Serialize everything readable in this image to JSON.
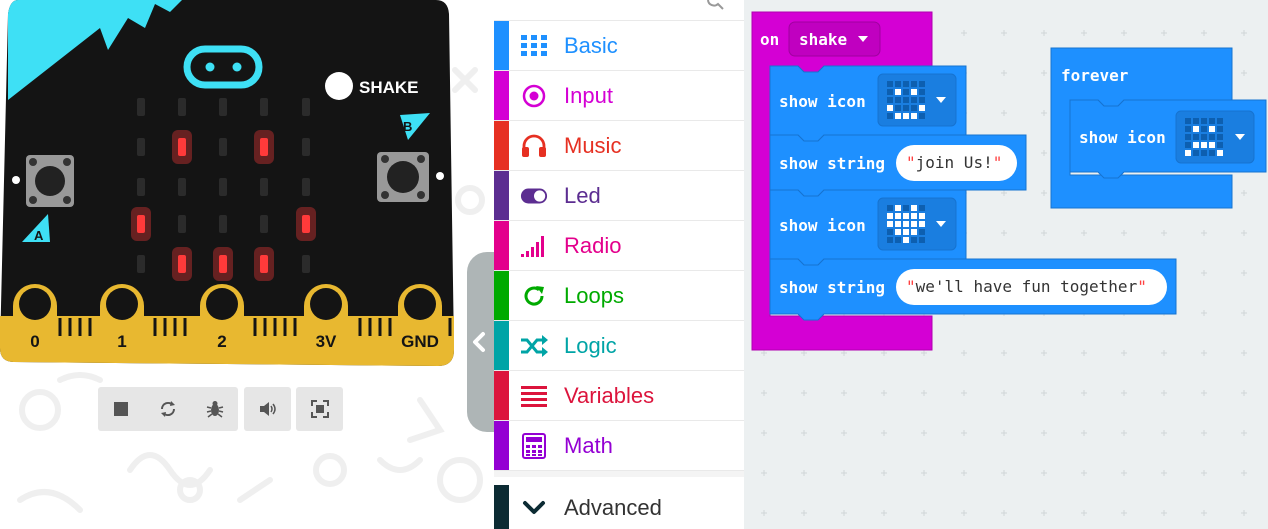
{
  "simulator": {
    "pin_labels": [
      "0",
      "1",
      "2",
      "3V",
      "GND"
    ],
    "shake_label": "SHAKE",
    "button_a_label": "A",
    "button_b_label": "B",
    "led_matrix": [
      [
        0,
        0,
        0,
        0,
        0
      ],
      [
        0,
        1,
        0,
        1,
        0
      ],
      [
        0,
        0,
        0,
        0,
        0
      ],
      [
        1,
        0,
        0,
        0,
        1
      ],
      [
        0,
        1,
        1,
        1,
        0
      ]
    ],
    "colors": {
      "board": "#141414",
      "accent": "#3ee0f5",
      "led_on": "#ff3a3a",
      "gold": "#e8b830"
    }
  },
  "controls": {
    "icons": [
      "stop-icon",
      "restart-icon",
      "debug-icon",
      "mute-icon",
      "fullscreen-icon"
    ]
  },
  "toolbox": {
    "categories": [
      {
        "label": "Basic",
        "color": "#1e90ff",
        "icon": "grid-icon"
      },
      {
        "label": "Input",
        "color": "#d400d4",
        "icon": "target-icon"
      },
      {
        "label": "Music",
        "color": "#e63022",
        "icon": "headphones-icon"
      },
      {
        "label": "Led",
        "color": "#5c2d91",
        "icon": "toggle-icon"
      },
      {
        "label": "Radio",
        "color": "#e3008c",
        "icon": "signal-icon"
      },
      {
        "label": "Loops",
        "color": "#00aa00",
        "icon": "refresh-icon"
      },
      {
        "label": "Logic",
        "color": "#00a4a6",
        "icon": "shuffle-icon"
      },
      {
        "label": "Variables",
        "color": "#dc143c",
        "icon": "list-icon"
      },
      {
        "label": "Math",
        "color": "#9400d3",
        "icon": "calculator-icon"
      }
    ],
    "advanced": {
      "label": "Advanced",
      "color": "#0c2b33"
    }
  },
  "workspace": {
    "on_event": {
      "keyword": "on",
      "dropdown_value": "shake",
      "color": "#d400d4",
      "statements": [
        {
          "type": "show icon",
          "icon": "happy"
        },
        {
          "type": "show string",
          "value": "join Us!"
        },
        {
          "type": "show icon",
          "icon": "heart"
        },
        {
          "type": "show string",
          "value": "we'll have fun together"
        }
      ]
    },
    "forever": {
      "label": "forever",
      "color": "#1e90ff",
      "statements": [
        {
          "type": "show icon",
          "icon": "sad"
        }
      ]
    }
  }
}
